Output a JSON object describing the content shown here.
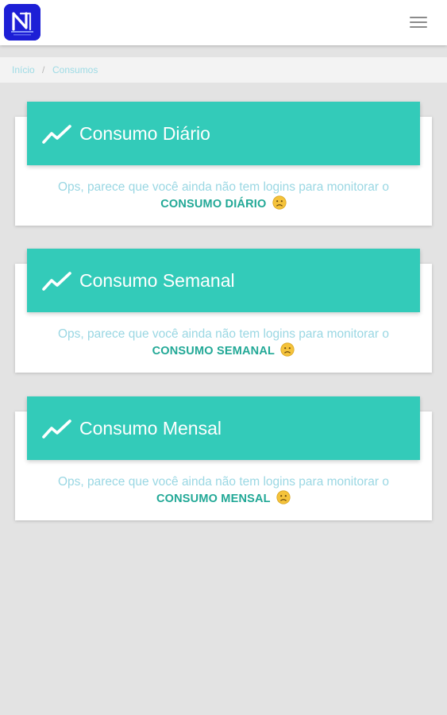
{
  "header": {
    "logo": "app-logo",
    "menu_icon": "hamburger-menu-icon"
  },
  "breadcrumb": {
    "items": [
      "Início",
      "Consumos"
    ],
    "separator": "/"
  },
  "cards": [
    {
      "title": "Consumo Diário",
      "message": "Ops, parece que você ainda não tem logins para monitorar o",
      "emphasis": "CONSUMO DIÁRIO"
    },
    {
      "title": "Consumo Semanal",
      "message": "Ops, parece que você ainda não tem logins para monitorar o",
      "emphasis": "CONSUMO SEMANAL"
    },
    {
      "title": "Consumo Mensal",
      "message": "Ops, parece que você ainda não tem logins para monitorar o",
      "emphasis": "CONSUMO MENSAL"
    }
  ],
  "icons": {
    "card": "trending-up-icon",
    "emoji": "sad-face-emoji-icon"
  },
  "colors": {
    "accent": "#33cbb9",
    "accent_text": "#21a896",
    "message_text": "#9ad7e3",
    "breadcrumb_link": "#9ddbe5",
    "background": "#e3e3e3",
    "logo_bg": "#1d1fd6"
  }
}
